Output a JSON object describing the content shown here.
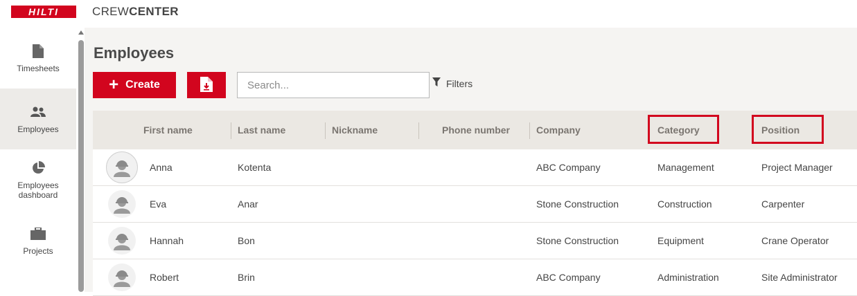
{
  "header": {
    "logo_text": "HILTI",
    "app_title_light": "CREW",
    "app_title_bold": "CENTER"
  },
  "sidebar": {
    "items": [
      {
        "label": "Timesheets",
        "icon": "document-icon"
      },
      {
        "label": "Employees",
        "icon": "people-icon",
        "active": true
      },
      {
        "label": "Employees dashboard",
        "icon": "pie-chart-icon"
      },
      {
        "label": "Projects",
        "icon": "briefcase-icon"
      }
    ]
  },
  "main": {
    "page_title": "Employees",
    "create_label": "Create",
    "search_placeholder": "Search...",
    "filters_label": "Filters"
  },
  "table": {
    "columns": [
      "First name",
      "Last name",
      "Nickname",
      "Phone number",
      "Company",
      "Category",
      "Position"
    ],
    "highlighted_columns": [
      "Category",
      "Position"
    ],
    "rows": [
      {
        "first": "Anna",
        "last": "Kotenta",
        "nickname": "",
        "phone": "",
        "company": "ABC Company",
        "category": "Management",
        "position": "Project Manager"
      },
      {
        "first": "Eva",
        "last": "Anar",
        "nickname": "",
        "phone": "",
        "company": "Stone Construction",
        "category": "Construction",
        "position": "Carpenter"
      },
      {
        "first": "Hannah",
        "last": "Bon",
        "nickname": "",
        "phone": "",
        "company": "Stone Construction",
        "category": "Equipment",
        "position": "Crane Operator"
      },
      {
        "first": "Robert",
        "last": "Brin",
        "nickname": "",
        "phone": "",
        "company": "ABC Company",
        "category": "Administration",
        "position": "Site Administrator"
      }
    ]
  },
  "colors": {
    "brand_red": "#d2051e",
    "header_bg": "#ebe8e3",
    "active_nav_bg": "#edebe8"
  }
}
